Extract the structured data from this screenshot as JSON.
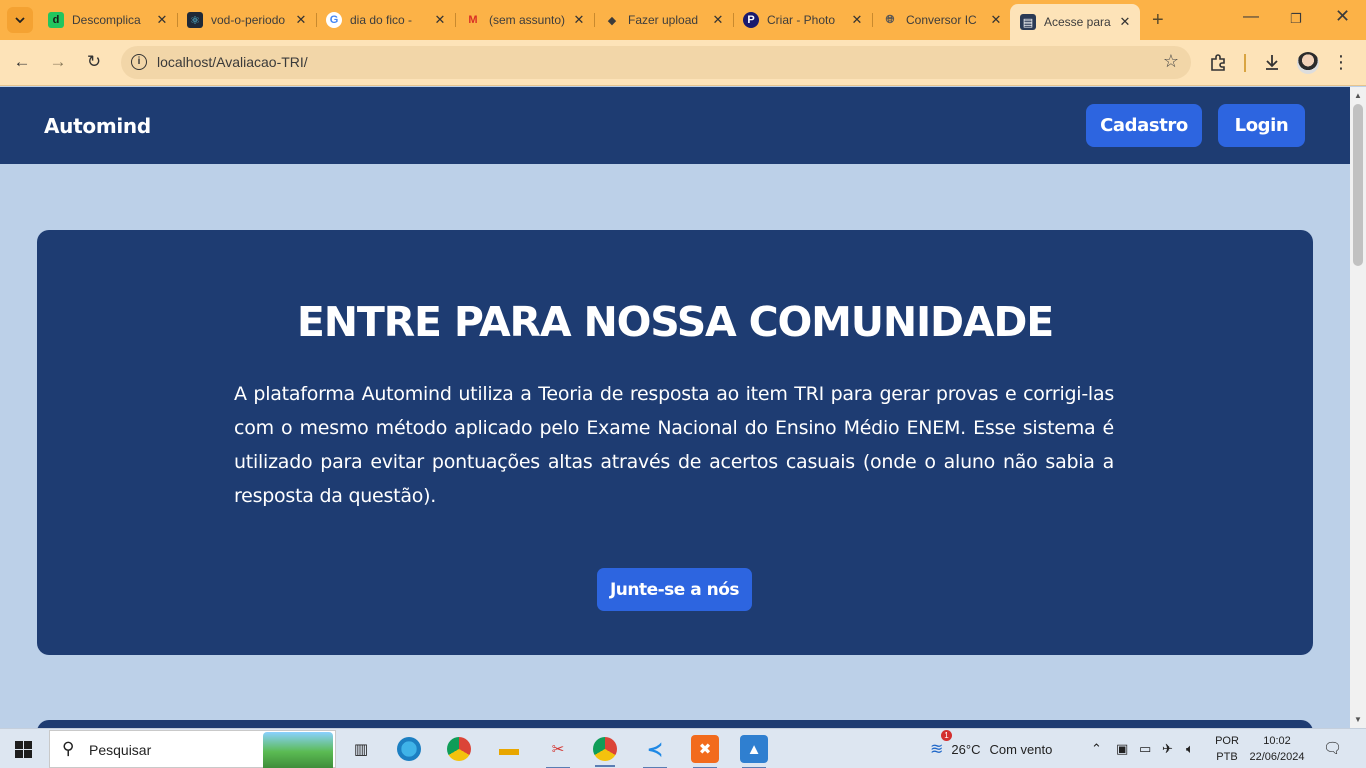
{
  "browser": {
    "tabs": [
      {
        "title": "Descomplica",
        "favicon": "d",
        "active": false
      },
      {
        "title": "vod-o-periodo",
        "favicon": "react-icon",
        "active": false
      },
      {
        "title": "dia do fico -",
        "favicon": "G",
        "active": false
      },
      {
        "title": "(sem assunto)",
        "favicon": "M",
        "active": false
      },
      {
        "title": "Fazer upload",
        "favicon": "layers-icon",
        "active": false
      },
      {
        "title": "Criar - Photo",
        "favicon": "P",
        "active": false
      },
      {
        "title": "Conversor IC",
        "favicon": "globe-icon",
        "active": false
      },
      {
        "title": "Acesse para",
        "favicon": "page-icon",
        "active": true
      }
    ],
    "url": "localhost/Avaliacao-TRI/"
  },
  "site": {
    "brand": "Automind",
    "nav": {
      "signup_label": "Cadastro",
      "login_label": "Login"
    },
    "hero": {
      "title": "ENTRE PARA NOSSA COMUNIDADE",
      "body": "A plataforma Automind utiliza a Teoria de resposta ao item TRI para gerar provas e corrigi-las com o mesmo método aplicado pelo Exame Nacional do Ensino Médio ENEM. Esse sistema é utilizado para evitar pontuações altas através de acertos casuais (onde o aluno não sabia a resposta da questão).",
      "cta_label": "Junte-se a nós"
    }
  },
  "colors": {
    "page_bg": "#bcd0e8",
    "navy": "#1e3c72",
    "button_blue": "#2d65e0",
    "browser_frame": "#fcb247"
  },
  "taskbar": {
    "search_placeholder": "Pesquisar",
    "weather": {
      "temp": "26°C",
      "desc": "Com vento",
      "badge": "1"
    },
    "language": {
      "line1": "POR",
      "line2": "PTB"
    },
    "clock": {
      "time": "10:02",
      "date": "22/06/2024"
    }
  }
}
